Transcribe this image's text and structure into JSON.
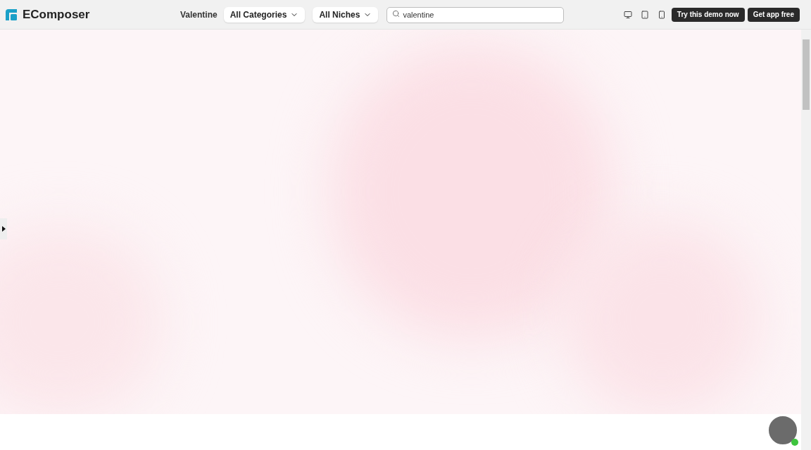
{
  "brand": {
    "name": "EComposer"
  },
  "toolbar": {
    "collection": "Valentine",
    "dropdowns": [
      "All Categories",
      "All Niches"
    ],
    "search": {
      "value": "valentine"
    }
  },
  "devices": [
    {
      "kind": "desktop",
      "selected": false
    },
    {
      "kind": "tablet",
      "selected": false
    },
    {
      "kind": "mobile",
      "selected": false
    }
  ],
  "buttons": [
    "Try this demo now",
    "Get app free"
  ],
  "chat": {
    "online": true
  }
}
